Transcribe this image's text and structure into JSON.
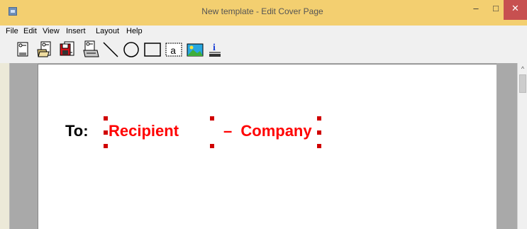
{
  "window": {
    "title": "New template - Edit Cover Page",
    "minimize_label": "–",
    "maximize_label": "□",
    "close_label": "✕"
  },
  "menu": [
    "File",
    "Edit",
    "View",
    "Insert",
    "Layout",
    "Help"
  ],
  "toolbar": {
    "tools": [
      {
        "name": "new-document",
        "icon": "new-page-icon"
      },
      {
        "name": "open",
        "icon": "open-folder-icon"
      },
      {
        "name": "save",
        "icon": "save-disk-icon"
      },
      {
        "name": "print",
        "icon": "print-icon"
      },
      {
        "name": "line",
        "icon": "line-icon"
      },
      {
        "name": "ellipse",
        "icon": "circle-icon"
      },
      {
        "name": "rectangle",
        "icon": "rectangle-icon"
      },
      {
        "name": "text",
        "icon": "text-box-icon",
        "label": "a"
      },
      {
        "name": "image",
        "icon": "picture-icon"
      },
      {
        "name": "field",
        "icon": "info-field-icon",
        "label": "i"
      }
    ]
  },
  "document": {
    "to_label": "To:",
    "recipient_field": "Recipient",
    "separator": "–",
    "company_field": "Company"
  },
  "colors": {
    "titlebar": "#f3cf70",
    "close_button": "#c75050",
    "field_text": "#ff0000",
    "selection_handle": "#d00000"
  }
}
